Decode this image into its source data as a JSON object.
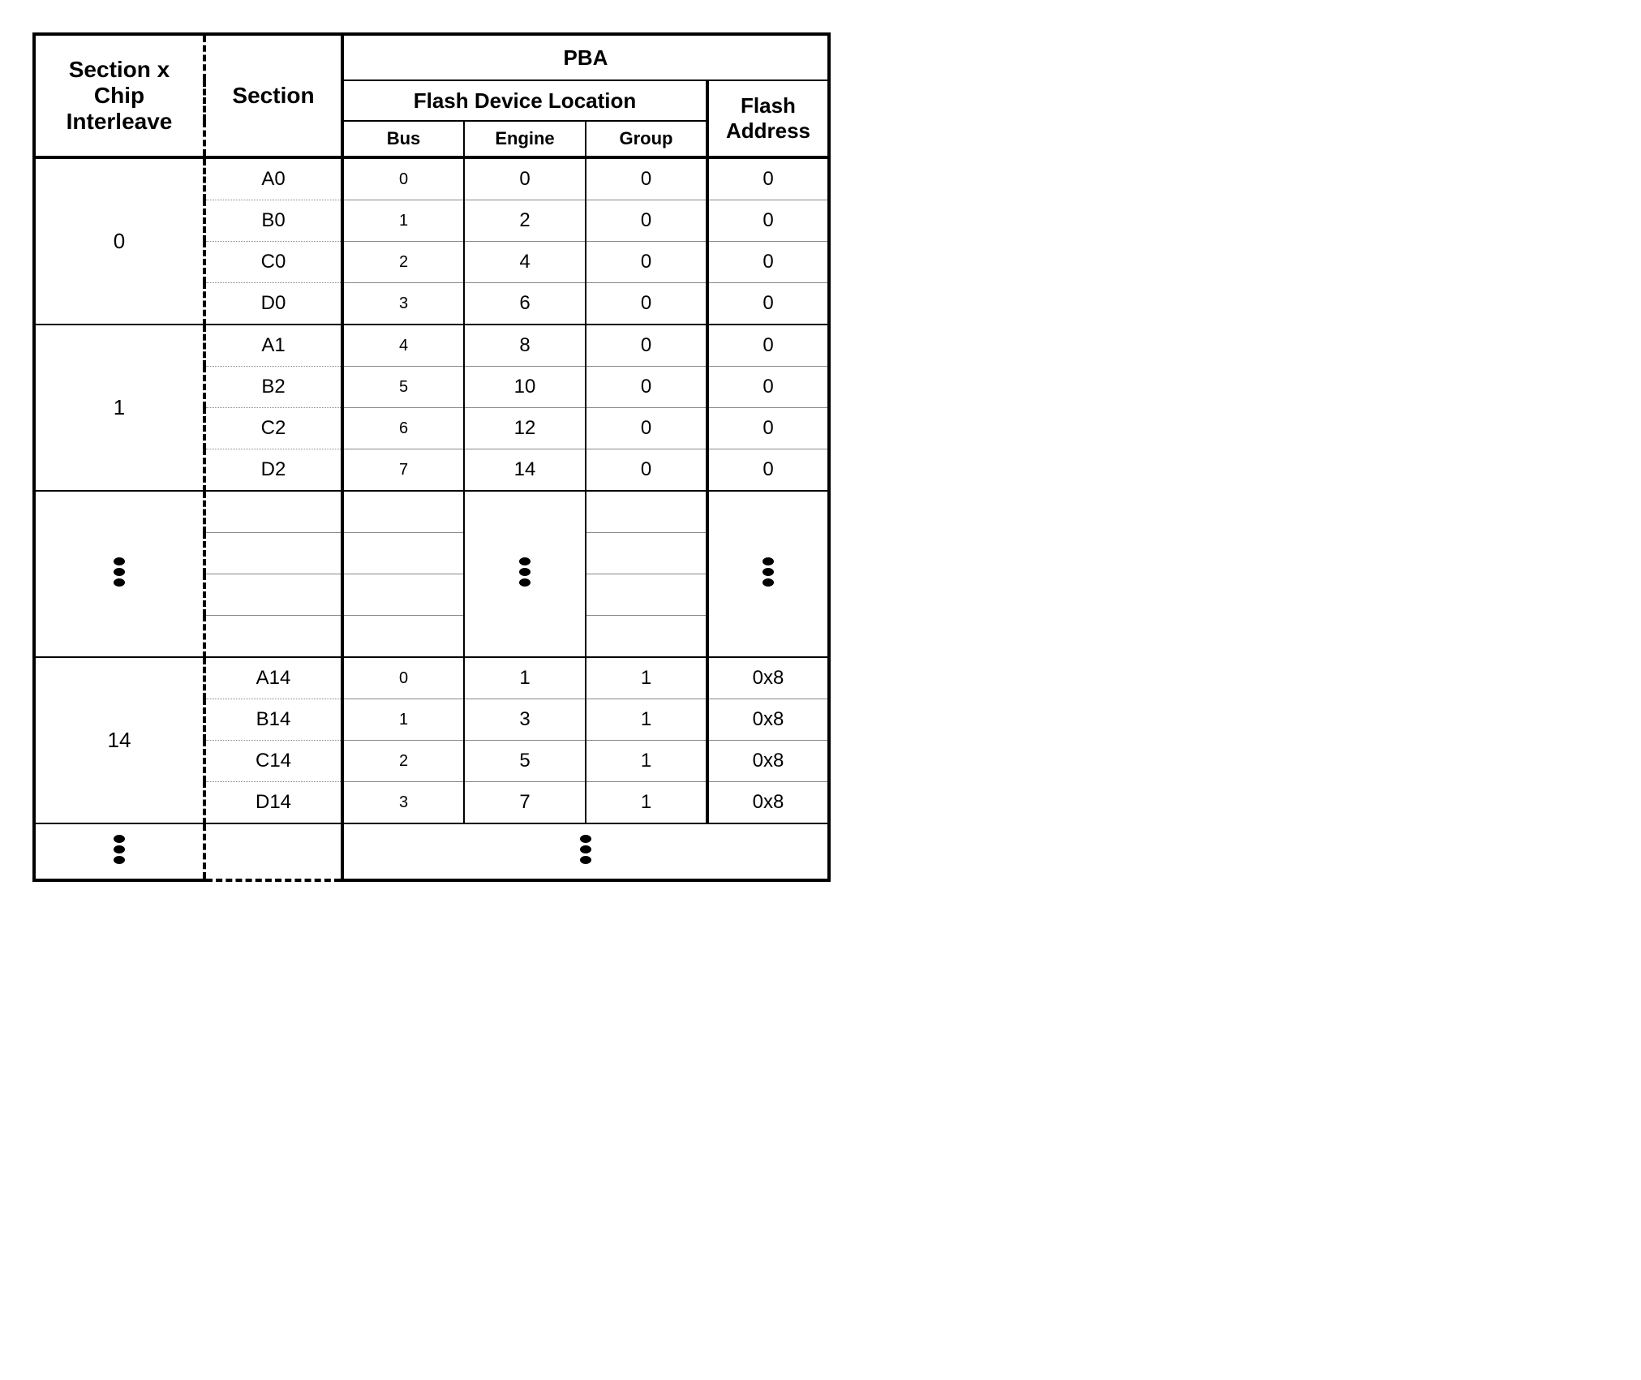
{
  "headers": {
    "interleave_l1": "Section x",
    "interleave_l2": "Chip",
    "interleave_l3": "Interleave",
    "section": "Section",
    "pba": "PBA",
    "flash_device_location": "Flash Device Location",
    "bus": "Bus",
    "engine": "Engine",
    "group": "Group",
    "flash_address_l1": "Flash",
    "flash_address_l2": "Address"
  },
  "groups": [
    {
      "interleave": "0",
      "rows": [
        {
          "section": "A0",
          "bus": "0",
          "engine": "0",
          "group": "0",
          "addr": "0"
        },
        {
          "section": "B0",
          "bus": "1",
          "engine": "2",
          "group": "0",
          "addr": "0"
        },
        {
          "section": "C0",
          "bus": "2",
          "engine": "4",
          "group": "0",
          "addr": "0"
        },
        {
          "section": "D0",
          "bus": "3",
          "engine": "6",
          "group": "0",
          "addr": "0"
        }
      ]
    },
    {
      "interleave": "1",
      "rows": [
        {
          "section": "A1",
          "bus": "4",
          "engine": "8",
          "group": "0",
          "addr": "0"
        },
        {
          "section": "B2",
          "bus": "5",
          "engine": "10",
          "group": "0",
          "addr": "0"
        },
        {
          "section": "C2",
          "bus": "6",
          "engine": "12",
          "group": "0",
          "addr": "0"
        },
        {
          "section": "D2",
          "bus": "7",
          "engine": "14",
          "group": "0",
          "addr": "0"
        }
      ]
    },
    {
      "interleave": "14",
      "rows": [
        {
          "section": "A14",
          "bus": "0",
          "engine": "1",
          "group": "1",
          "addr": "0x8"
        },
        {
          "section": "B14",
          "bus": "1",
          "engine": "3",
          "group": "1",
          "addr": "0x8"
        },
        {
          "section": "C14",
          "bus": "2",
          "engine": "5",
          "group": "1",
          "addr": "0x8"
        },
        {
          "section": "D14",
          "bus": "3",
          "engine": "7",
          "group": "1",
          "addr": "0x8"
        }
      ]
    }
  ]
}
